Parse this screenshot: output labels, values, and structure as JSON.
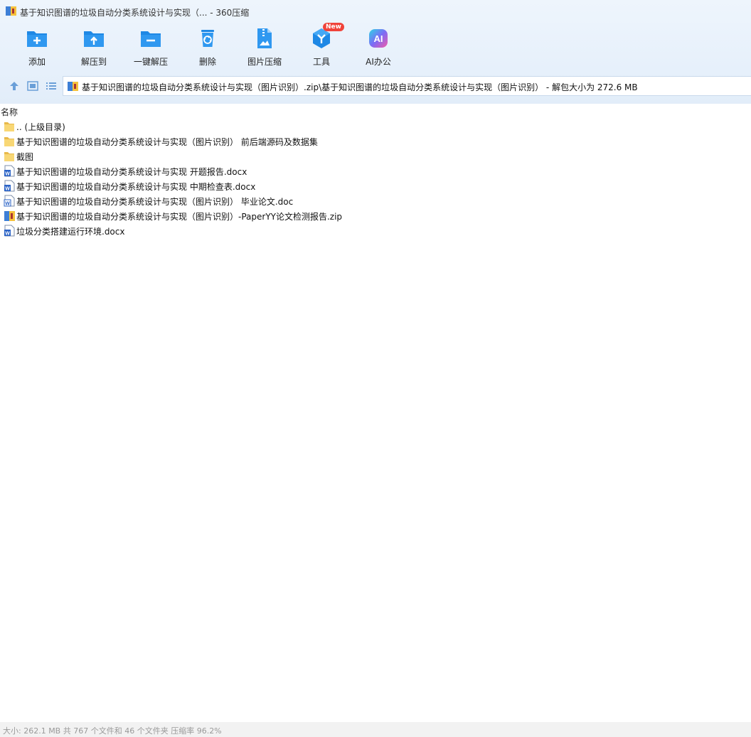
{
  "window": {
    "title": "基于知识图谱的垃圾自动分类系统设计与实现（... - 360压缩"
  },
  "toolbar": {
    "items": [
      {
        "label": "添加",
        "icon": "add-folder-icon"
      },
      {
        "label": "解压到",
        "icon": "extract-to-icon"
      },
      {
        "label": "一键解压",
        "icon": "one-click-extract-icon"
      },
      {
        "label": "删除",
        "icon": "trash-icon"
      },
      {
        "label": "图片压缩",
        "icon": "image-compress-icon"
      },
      {
        "label": "工具",
        "icon": "tools-icon",
        "badge": "New"
      },
      {
        "label": "AI办公",
        "icon": "ai-office-icon"
      }
    ]
  },
  "nav": {
    "buttons": [
      "up-arrow-icon",
      "thumbnail-view-icon",
      "list-view-icon"
    ],
    "path": "基于知识图谱的垃圾自动分类系统设计与实现（图片识别）.zip\\基于知识图谱的垃圾自动分类系统设计与实现（图片识别） - 解包大小为 272.6 MB"
  },
  "list": {
    "column_name": "名称",
    "rows": [
      {
        "name": ".. (上级目录)",
        "type": "folder"
      },
      {
        "name": "基于知识图谱的垃圾自动分类系统设计与实现（图片识别） 前后端源码及数据集",
        "type": "folder"
      },
      {
        "name": "截图",
        "type": "folder"
      },
      {
        "name": "基于知识图谱的垃圾自动分类系统设计与实现 开题报告.docx",
        "type": "word"
      },
      {
        "name": "基于知识图谱的垃圾自动分类系统设计与实现 中期检查表.docx",
        "type": "word"
      },
      {
        "name": "基于知识图谱的垃圾自动分类系统设计与实现（图片识别） 毕业论文.doc",
        "type": "word-doc"
      },
      {
        "name": "基于知识图谱的垃圾自动分类系统设计与实现（图片识别）-PaperYY论文检测报告.zip",
        "type": "zip"
      },
      {
        "name": "垃圾分类搭建运行环境.docx",
        "type": "word"
      }
    ]
  },
  "status": {
    "text": "大小: 262.1 MB 共 767 个文件和 46 个文件夹 压缩率 96.2%"
  },
  "colors": {
    "accent_blue": "#1e88e5",
    "folder_yellow": "#f8d775",
    "badge_red": "#f0433a"
  }
}
